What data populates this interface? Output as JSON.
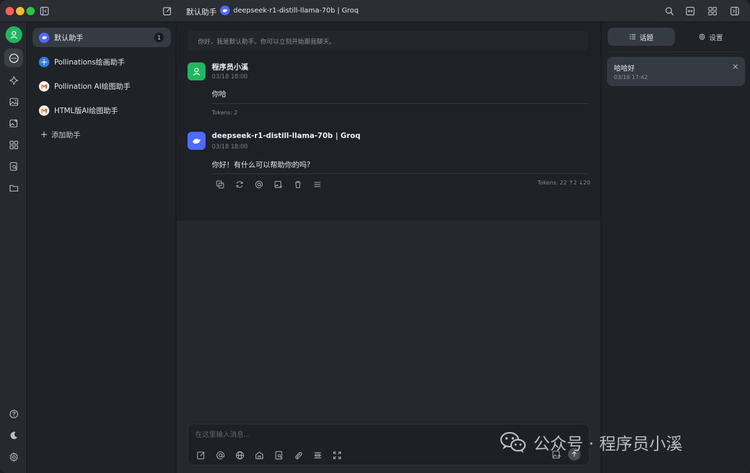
{
  "titlebar": {
    "assistant_name": "默认助手",
    "model_name": "deepseek-r1-distill-llama-70b | Groq"
  },
  "assistants": {
    "items": [
      {
        "label": "默认助手",
        "badge": "1"
      },
      {
        "label": "Pollinations绘画助手"
      },
      {
        "label": "Pollination AI绘图助手"
      },
      {
        "label": "HTML版AI绘图助手"
      }
    ],
    "add_label": "添加助手"
  },
  "chat": {
    "welcome": "你好，我是默认助手。你可以立刻开始跟我聊天。",
    "messages": [
      {
        "name": "程序员小溪",
        "time": "03/18 18:00",
        "text": "你哈",
        "tokens": "Tokens: 2"
      },
      {
        "name": "deepseek-r1-distill-llama-70b | Groq",
        "time": "03/18 18:00",
        "text": "你好！有什么可以帮助你的吗?",
        "tokens": "Tokens: 22 ↑2 ↓20"
      }
    ],
    "input_placeholder": "在这里输入消息..."
  },
  "right_panel": {
    "tabs": [
      {
        "label": "话题",
        "icon": "list-icon"
      },
      {
        "label": "设置",
        "icon": "gear-icon"
      }
    ],
    "topics": [
      {
        "title": "哈哈好",
        "time": "03/18 17:42"
      }
    ]
  },
  "watermark": {
    "text": "公众号 · 程序员小溪"
  },
  "colors": {
    "accent_green": "#1fb860",
    "deepseek_blue": "#4d6bfe",
    "background": "#1e2228"
  }
}
